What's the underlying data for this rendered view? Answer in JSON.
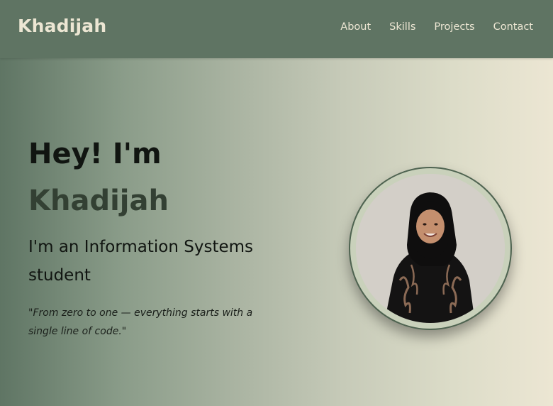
{
  "header": {
    "logo": "Khadijah",
    "nav": [
      {
        "label": "About"
      },
      {
        "label": "Skills"
      },
      {
        "label": "Projects"
      },
      {
        "label": "Contact"
      }
    ]
  },
  "hero": {
    "greeting": "Hey! I'm",
    "name": "Khadijah",
    "subtitle": "I'm an Information Systems student",
    "quote": "\"From zero to one — everything starts with a single line of code.\""
  },
  "colors": {
    "nav_bg": "#5f7463",
    "nav_text": "#ece6d3",
    "gradient_start": "#5f7564",
    "gradient_end": "#ece6d3",
    "name_color": "#334033",
    "frame_border": "#4e6350"
  },
  "profile_photo": {
    "alt": "portrait"
  }
}
